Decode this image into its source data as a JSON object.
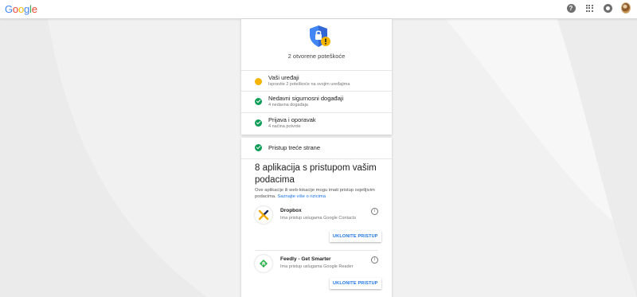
{
  "brand": {
    "logo_letters": [
      "G",
      "o",
      "o",
      "g",
      "l",
      "e"
    ],
    "logo_colors": [
      "#4285f4",
      "#ea4335",
      "#fbbc05",
      "#4285f4",
      "#34a853",
      "#ea4335"
    ]
  },
  "topbar_icons": [
    "help-icon",
    "apps-grid-icon",
    "notifications-icon",
    "avatar"
  ],
  "summary": {
    "text": "2 otvorene poteškoće"
  },
  "checkup_items": [
    {
      "title": "Vaši uređaji",
      "subtitle": "Ispravite 2 poteškoće na svojim uređajima",
      "status": "warning"
    },
    {
      "title": "Nedavni sigurnosni događaji",
      "subtitle": "4 nedavna događaja",
      "status": "ok"
    },
    {
      "title": "Prijava i oporavak",
      "subtitle": "4 načina potvrde",
      "status": "ok"
    }
  ],
  "third_party": {
    "section_title": "Pristup treće strane",
    "headline": "8 aplikacija s pristupom vašim podacima",
    "description": "Ove aplikacije ili web-lokacije mogu imati pristup osjetljivim podacima.",
    "learn_more": "Saznajte više o rizicima",
    "apps": [
      {
        "name": "Dropbox",
        "access": "Ima pristup uslugama Google Contacts",
        "button": "UKLONITE PRISTUP"
      },
      {
        "name": "Feedly - Get Smarter",
        "access": "Ima pristup uslugama Google Reader",
        "button": "UKLONITE PRISTUP"
      }
    ]
  },
  "colors": {
    "warning": "#f4b400",
    "ok": "#0f9d58",
    "shield": "#4285f4",
    "link": "#1a73e8"
  }
}
